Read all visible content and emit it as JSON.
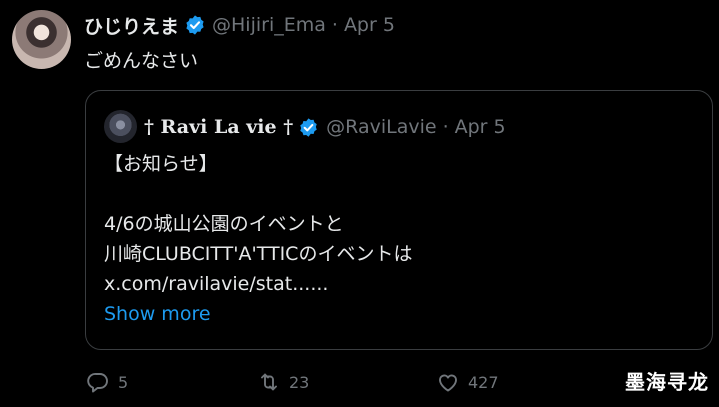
{
  "tweet": {
    "author_name": "ひじりえま",
    "handle": "@Hijiri_Ema",
    "separator": "·",
    "date": "Apr 5",
    "text": "ごめんなさい"
  },
  "quote": {
    "author_name": "† Ravi La vie †",
    "handle": "@RaviLavie",
    "separator": "·",
    "date": "Apr 5",
    "lines": [
      "【お知らせ】",
      "",
      "4/6の城山公園のイベントと",
      "川崎CLUBCITT'A'TTICのイベントは",
      "x.com/ravilavie/stat......"
    ],
    "show_more": "Show more"
  },
  "actions": {
    "reply_count": "5",
    "retweet_count": "23",
    "like_count": "427"
  },
  "watermark": "墨海寻龙",
  "colors": {
    "background": "#000000",
    "text": "#e7e9ea",
    "muted": "#71767b",
    "link": "#1d9bf0",
    "verified": "#1d9bf0"
  },
  "icons": [
    "verified-badge-icon",
    "reply-icon",
    "retweet-icon",
    "like-icon"
  ]
}
